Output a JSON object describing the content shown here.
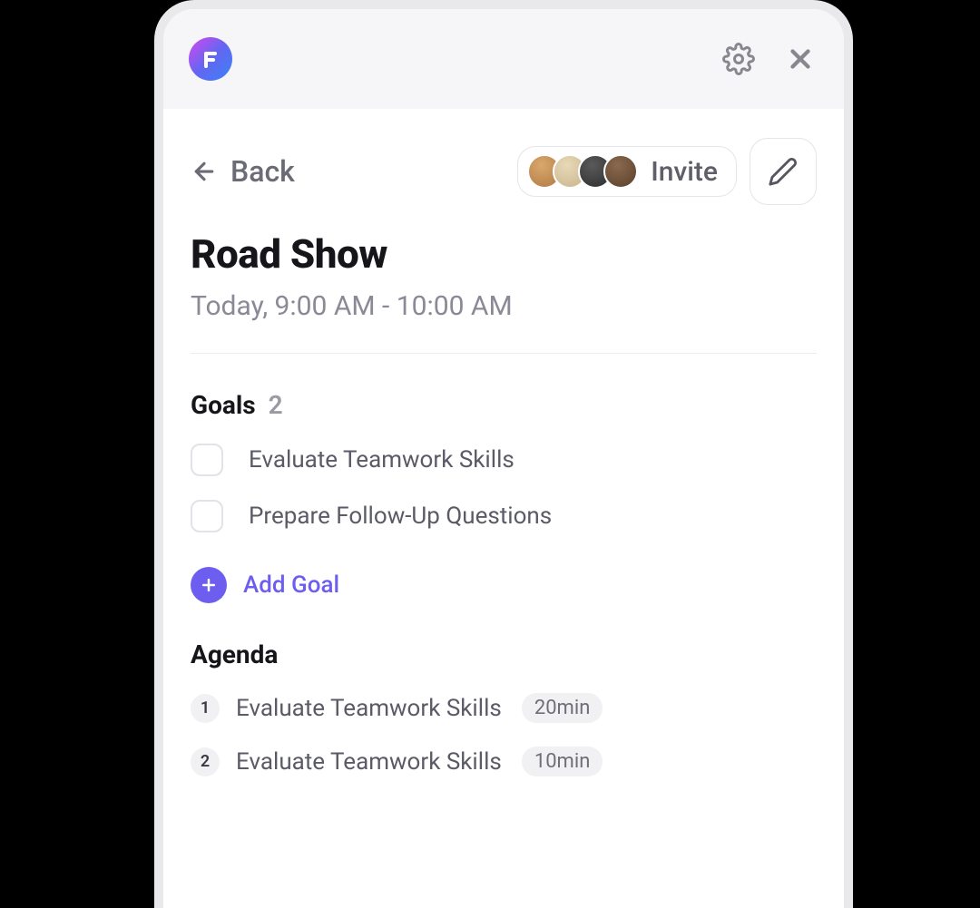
{
  "header": {
    "back_label": "Back",
    "invite_label": "Invite"
  },
  "meeting": {
    "title": "Road Show",
    "timestamp": "Today, 9:00 AM - 10:00 AM"
  },
  "goals": {
    "heading": "Goals",
    "count": "2",
    "items": [
      {
        "label": "Evaluate Teamwork Skills"
      },
      {
        "label": "Prepare Follow-Up Questions"
      }
    ],
    "add_label": "Add Goal"
  },
  "agenda": {
    "heading": "Agenda",
    "items": [
      {
        "num": "1",
        "label": "Evaluate Teamwork Skills",
        "duration": "20min"
      },
      {
        "num": "2",
        "label": "Evaluate Teamwork Skills",
        "duration": "10min"
      }
    ]
  }
}
